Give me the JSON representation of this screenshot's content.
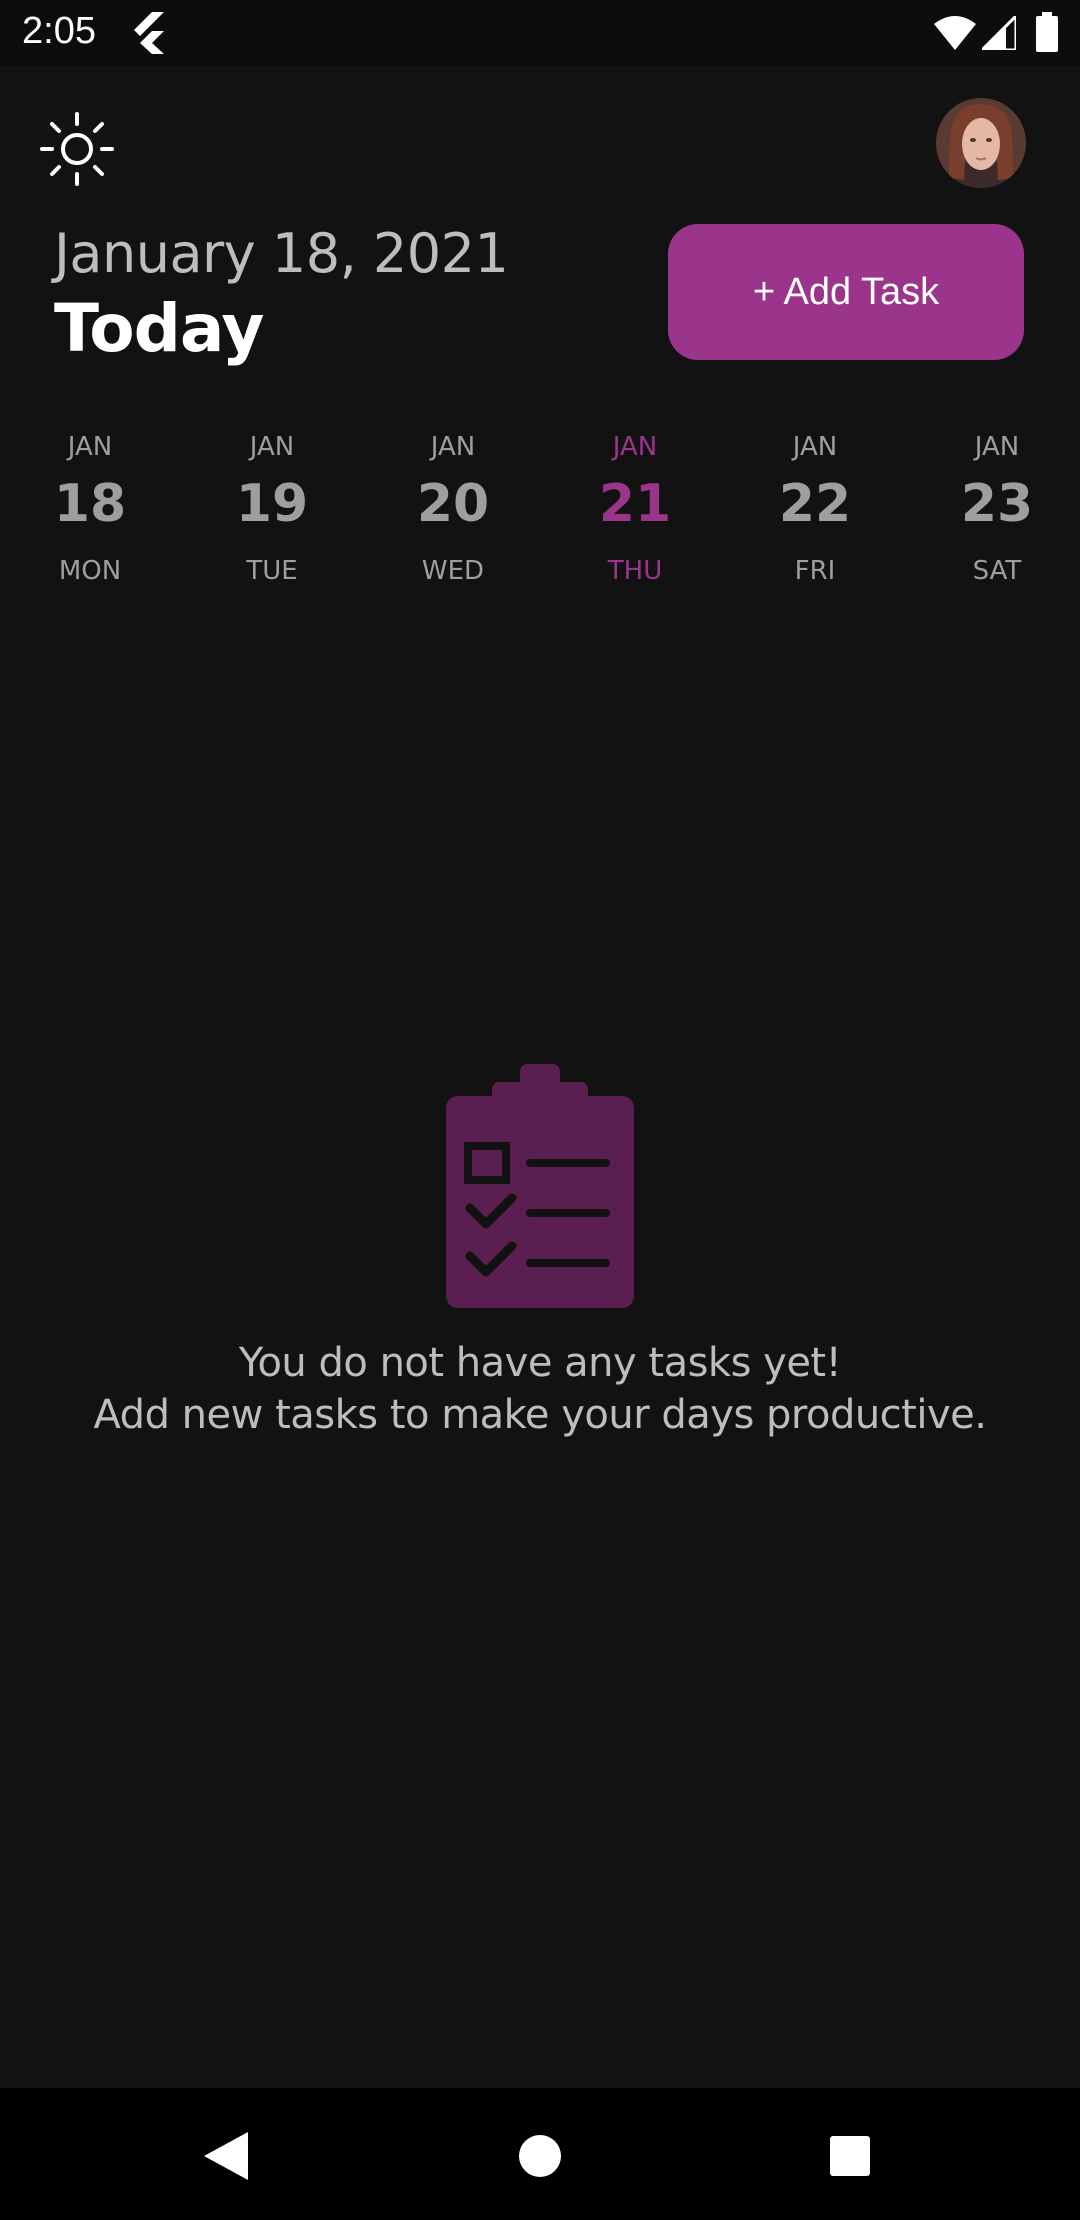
{
  "status_bar": {
    "time": "2:05",
    "icons": [
      "flutter-icon",
      "wifi-icon",
      "signal-icon",
      "battery-icon"
    ]
  },
  "header": {
    "theme_icon": "sun-icon",
    "date": "January 18, 2021",
    "title": "Today",
    "add_task_label": "+ Add Task"
  },
  "colors": {
    "background": "#121212",
    "accent": "#9b358b",
    "text_muted": "#9e9e9e",
    "text_primary": "#ffffff",
    "empty_icon": "#5a1f50"
  },
  "date_strip": [
    {
      "month": "JAN",
      "day": "18",
      "weekday": "MON",
      "selected": false
    },
    {
      "month": "JAN",
      "day": "19",
      "weekday": "TUE",
      "selected": false
    },
    {
      "month": "JAN",
      "day": "20",
      "weekday": "WED",
      "selected": false
    },
    {
      "month": "JAN",
      "day": "21",
      "weekday": "THU",
      "selected": true
    },
    {
      "month": "JAN",
      "day": "22",
      "weekday": "FRI",
      "selected": false
    },
    {
      "month": "JAN",
      "day": "23",
      "weekday": "SAT",
      "selected": false
    }
  ],
  "empty_state": {
    "icon": "clipboard-checklist-icon",
    "line1": "You do not have any tasks yet!",
    "line2": "Add new tasks to make your days productive."
  },
  "nav_bar": {
    "icons": [
      "back-icon",
      "home-icon",
      "recents-icon"
    ]
  }
}
